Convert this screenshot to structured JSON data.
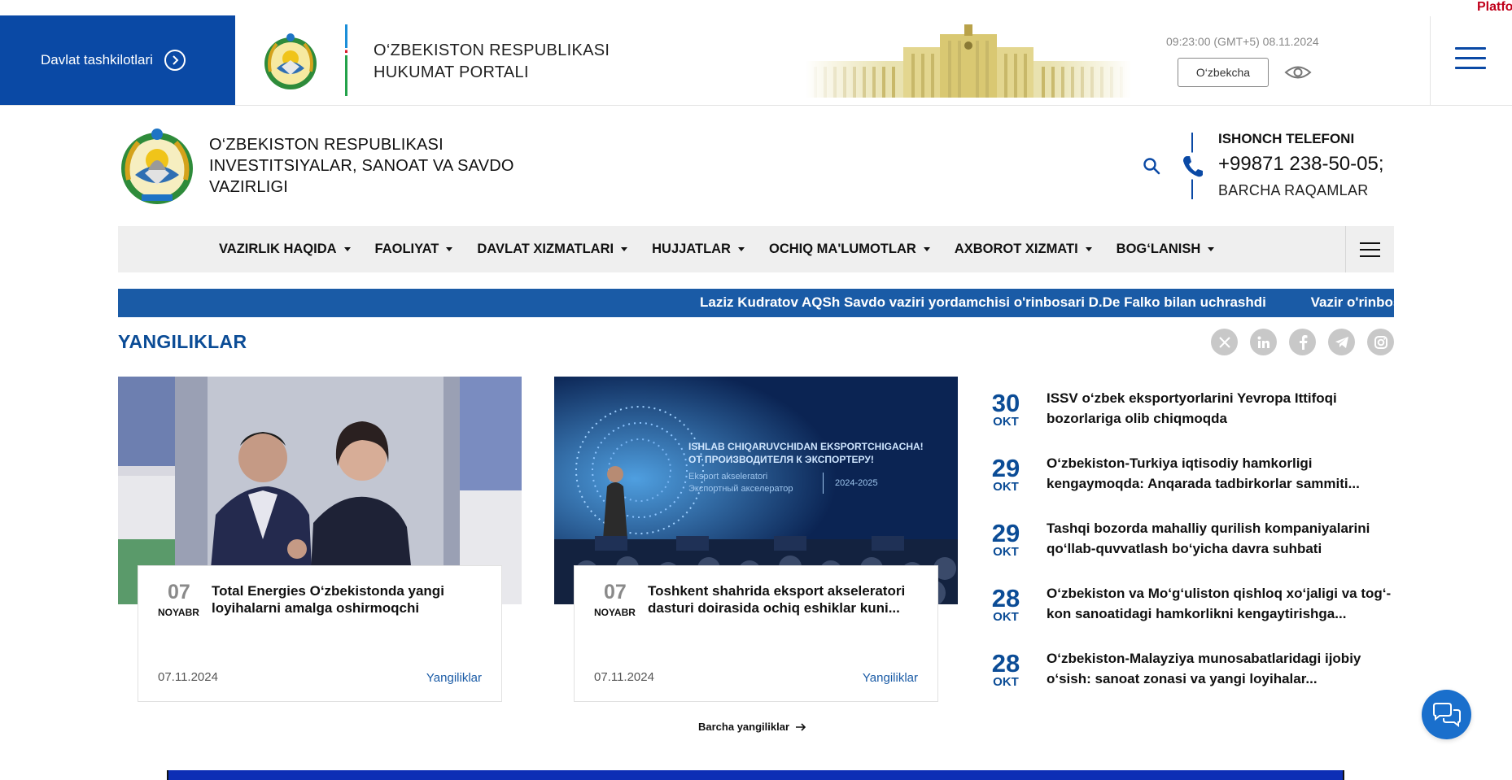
{
  "topbar": {
    "gov_button_label": "Davlat tashkilotlari",
    "portal_title_line1": "O‘ZBEKISTON RESPUBLIKASI",
    "portal_title_line2": "HUKUMAT PORTALI",
    "datetime": "09:23:00 (GMT+5) 08.11.2024",
    "language": "O‘zbekcha",
    "corner_text": "Platfo"
  },
  "ministry": {
    "title_line1": "O‘ZBEKISTON RESPUBLIKASI",
    "title_line2": "INVESTITSIYALAR, SANOAT VA SAVDO",
    "title_line3": "VAZIRLIGI",
    "hotline_label": "ISHONCH TELEFONI",
    "hotline_number": "+99871 238-50-05;",
    "hotline_all": "BARCHA RAQAMLAR"
  },
  "nav": {
    "items": [
      {
        "label": "VAZIRLIK HAQIDA"
      },
      {
        "label": "FAOLIYAT"
      },
      {
        "label": "DAVLAT XIZMATLARI"
      },
      {
        "label": "HUJJATLAR"
      },
      {
        "label": "OCHIQ MA'LUMOTLAR"
      },
      {
        "label": "AXBOROT XIZMATI"
      },
      {
        "label": "BOG‘LANISH"
      }
    ]
  },
  "ticker": {
    "items": [
      "Laziz Kudratov AQSh Savdo vaziri yordamchisi o'rinbosari D.De Falko bilan uchrashdi",
      "Vazir o'rinbosa"
    ]
  },
  "news": {
    "section_title": "YANGILIKLAR",
    "featured": [
      {
        "day": "07",
        "month": "NOYABR",
        "title": "Total Energies O‘zbekistonda yangi loyihalarni amalga oshirmoqchi",
        "date": "07.11.2024",
        "category": "Yangiliklar"
      },
      {
        "day": "07",
        "month": "NOYABR",
        "title": "Toshkent shahrida eksport akseleratori dasturi doirasida ochiq eshiklar kuni...",
        "date": "07.11.2024",
        "category": "Yangiliklar"
      }
    ],
    "image2": {
      "line1": "ISHLAB CHIQARUVCHIDAN EKSPORTCHIGACHA!",
      "line2": "ОТ ПРОИЗВОДИТЕЛЯ К ЭКСПОРТЕРУ!",
      "line3": "Eksport akseleratori",
      "line4": "Экспортный акселератор",
      "years": "2024-2025"
    },
    "list": [
      {
        "day": "30",
        "month": "OKT",
        "title": "ISSV o‘zbek eksportyorlarini Yevropa Ittifoqi bozorlariga olib chiqmoqda"
      },
      {
        "day": "29",
        "month": "OKT",
        "title": "O‘zbekiston-Turkiya iqtisodiy hamkorligi kengaymoqda: Anqarada tadbirkorlar sammiti..."
      },
      {
        "day": "29",
        "month": "OKT",
        "title": "Tashqi bozorda mahalliy qurilish kompaniyalarini qo‘llab-quvvatlash bo‘yicha davra suhbati"
      },
      {
        "day": "28",
        "month": "OKT",
        "title": "O‘zbekiston va Mo‘g‘uliston qishloq xo‘jaligi va tog‘-kon sanoatidagi hamkorlikni kengaytirishga..."
      },
      {
        "day": "28",
        "month": "OKT",
        "title": "O‘zbekiston-Malayziya munosabatlaridagi ijobiy o‘sish: sanoat zonasi va yangi loyihalar..."
      }
    ],
    "all_news_label": "Barcha yangiliklar"
  },
  "socials": [
    "x-icon",
    "linkedin-icon",
    "facebook-icon",
    "telegram-icon",
    "instagram-icon"
  ],
  "colors": {
    "primary": "#0a49a5",
    "ticker": "#1a5ba6",
    "accent_text": "#0b4c96"
  }
}
